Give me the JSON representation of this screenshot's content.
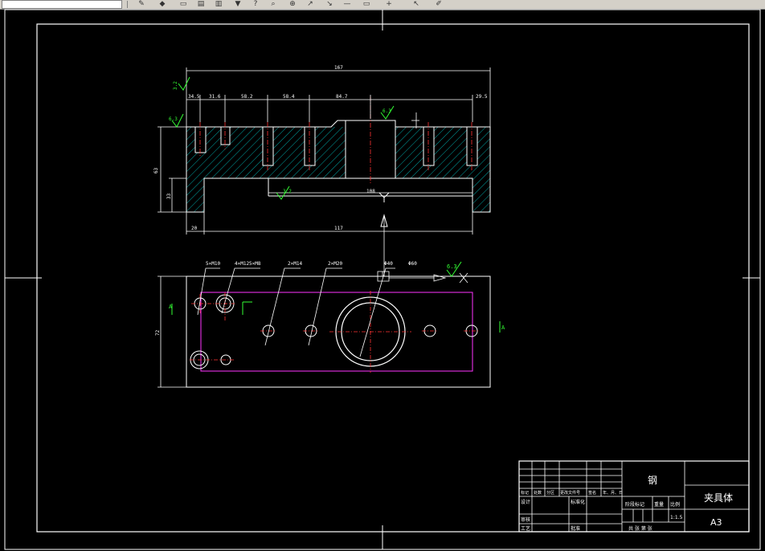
{
  "toolbar": {
    "icons": [
      "layer-icon",
      "match-properties-icon",
      "tool-a-icon",
      "tool-b-icon",
      "tool-c-icon",
      "dropdown-icon",
      "help-icon",
      "zoom-icon",
      "zoom-window-icon",
      "arrow-icon",
      "line-icon",
      "rect-icon",
      "plus-icon",
      "cursor-icon",
      "pen-icon"
    ]
  },
  "colors": {
    "background": "#000000",
    "outline": "#ffffff",
    "dimension": "#ffffff",
    "hatch": "#00cccc",
    "centerline": "#ff3333",
    "surface_mark": "#33ff33",
    "hidden_rect": "#ff33ff"
  },
  "front_view": {
    "overall_dim": "167",
    "sub_dims": [
      "34.5",
      "31.6",
      "58.2",
      "58.4",
      "84.7",
      "29.5"
    ],
    "height_dim": "63",
    "step_dim": "33",
    "inner_dim": "108",
    "bottom_left_dim": "20",
    "bottom_dim": "117",
    "roughness_marks": [
      "3.2",
      "6.3",
      "6.3",
      "3.2"
    ]
  },
  "top_view": {
    "height_dim": "72",
    "hole_labels": [
      "5×M10",
      "4×M12",
      "5×M8",
      "2×M14",
      "2×M20",
      "Φ40",
      "Φ60"
    ],
    "section_label_left": "A",
    "section_label_right": "A",
    "roughness": "6.3"
  },
  "title_block": {
    "material": "钢",
    "part_name": "夹具体",
    "sheet_size": "A3",
    "scale_header": "比例",
    "scale": "1:1.5",
    "weight_header": "重量",
    "stage_header": "阶段标记",
    "sheet_row": "共 张 第 张",
    "rev_headers": [
      "标记",
      "处数",
      "分区",
      "更改文件号",
      "签名",
      "年、月、日"
    ],
    "designer": "设计",
    "standardize": "标准化",
    "checker": "审核",
    "process": "工艺",
    "approve": "批准"
  }
}
